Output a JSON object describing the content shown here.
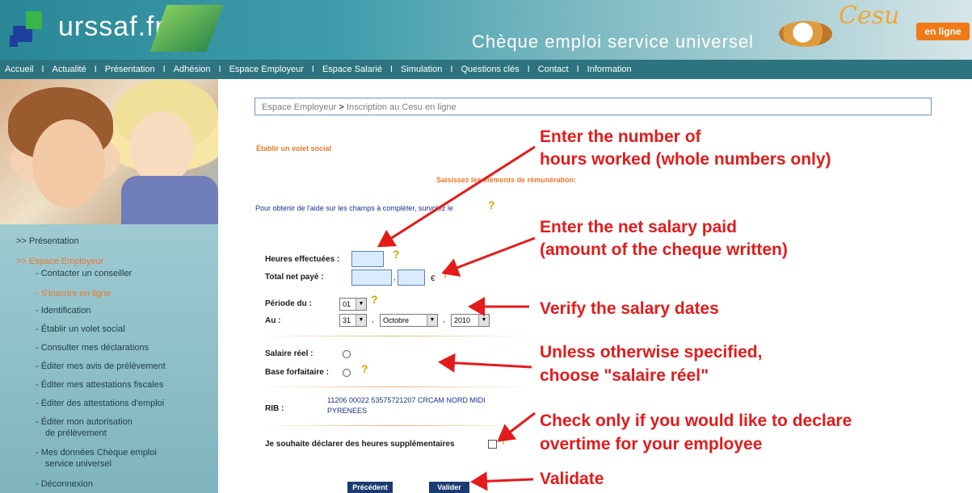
{
  "header": {
    "logo_text": "urssaf.fr",
    "title": "Chèque emploi service universel",
    "brand": "Cesu",
    "brand_badge": "en ligne"
  },
  "nav": {
    "items": [
      "Accueil",
      "Actualité",
      "Présentation",
      "Adhésion",
      "Espace Employeur",
      "Espace Salarié",
      "Simulation",
      "Questions clés",
      "Contact",
      "Information"
    ],
    "separator": "I"
  },
  "sidebar": {
    "presentation": ">> Présentation",
    "espace_employeur": ">> Espace Employeur",
    "items": [
      "- Contacter un conseiller",
      "- S'inscrire en ligne",
      "- Identification",
      "- Établir un volet social",
      "- Consulter mes déclarations",
      "- Éditer mes avis de prélèvement",
      "- Éditer mes attestations fiscales",
      "- Éditer des attestations d'emploi",
      "- Éditer mon autorisation",
      "de prélèvement",
      "- Mes données Chèque emploi",
      "service universel",
      "- Déconnexion"
    ]
  },
  "breadcrumb": {
    "part1": "Espace Employeur",
    "arrow": ">",
    "part2": "Inscription au Cesu en ligne"
  },
  "form": {
    "title": "Établir un volet social",
    "subtitle": "Saisissez les éléments de rémunération:",
    "help_text": "Pour obtenir de l'aide sur les champs à compléter, survolez le",
    "help_mark": "?",
    "heures_label": "Heures effectuées :",
    "heures_value": "",
    "total_label": "Total net payé :",
    "total_euros": "",
    "total_cents": "",
    "euro": "€",
    "periode_label": "Période du :",
    "periode_day": "01",
    "au_label": "Au :",
    "au_day": "31",
    "au_month": "Octobre",
    "au_year": "2010",
    "comma": ",",
    "salaire_reel_label": "Salaire réel :",
    "base_forfaitaire_label": "Base forfaitaire :",
    "rib_label": "RIB :",
    "rib_value": "11206 00022 53575721207 CRCAM NORD MIDI PYRENEES",
    "overtime_label": "Je souhaite déclarer des heures supplémentaires",
    "prev_button": "Précédent",
    "validate_button": "Valider"
  },
  "annotations": {
    "hours_line1": "Enter the number of",
    "hours_line2": "hours worked (whole numbers only)",
    "salary_line1": "Enter the net salary paid",
    "salary_line2": "(amount of the cheque written)",
    "dates": "Verify the salary dates",
    "salaire_line1": "Unless otherwise specified,",
    "salaire_line2": "choose \"salaire réel\"",
    "overtime_line1": "Check only if you would like to declare",
    "overtime_line2": "overtime for your employee",
    "validate": "Validate"
  },
  "colors": {
    "header": "#2a8796",
    "navbar": "#2d7480",
    "sidebar": "#8fc0c9",
    "accent_orange": "#e8792b",
    "annotation_red": "#e31b1b",
    "button": "#1c3b70",
    "input_fill": "#d9ecff"
  }
}
